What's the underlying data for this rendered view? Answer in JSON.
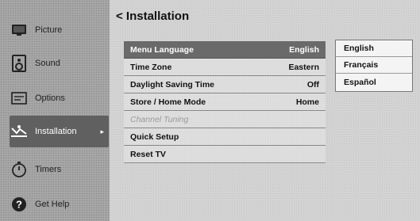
{
  "sidebar": {
    "items": [
      {
        "label": "Picture",
        "icon": "tv-icon"
      },
      {
        "label": "Sound",
        "icon": "speaker-icon"
      },
      {
        "label": "Options",
        "icon": "options-icon"
      },
      {
        "label": "Installation",
        "icon": "installation-icon",
        "arrow": "▸"
      },
      {
        "label": "Timers",
        "icon": "timer-icon"
      },
      {
        "label": "Get Help",
        "icon": "help-icon"
      }
    ]
  },
  "header": {
    "title": "< Installation"
  },
  "menu": {
    "rows": [
      {
        "label": "Menu Language",
        "value": "English"
      },
      {
        "label": "Time Zone",
        "value": "Eastern"
      },
      {
        "label": "Daylight Saving Time",
        "value": "Off"
      },
      {
        "label": "Store / Home Mode",
        "value": "Home"
      },
      {
        "label": "Channel Tuning",
        "value": ""
      },
      {
        "label": "Quick Setup",
        "value": ""
      },
      {
        "label": "Reset TV",
        "value": ""
      }
    ]
  },
  "language_submenu": {
    "options": [
      "English",
      "Français",
      "Español"
    ]
  }
}
